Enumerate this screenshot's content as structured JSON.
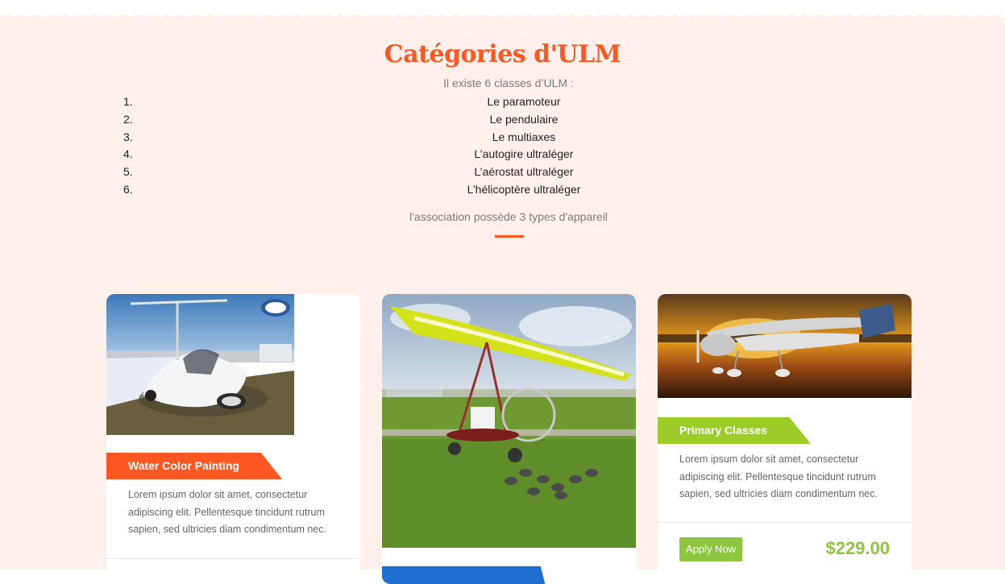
{
  "section": {
    "title": "Catégories d'ULM",
    "intro": "Il existe 6 classes d’ULM :",
    "items": [
      {
        "num": "1.",
        "label": "Le paramoteur"
      },
      {
        "num": "2.",
        "label": "Le pendulaire"
      },
      {
        "num": "3.",
        "label": "Le multiaxes"
      },
      {
        "num": "4.",
        "label": "L’autogire ultraléger"
      },
      {
        "num": "5.",
        "label": "L’aérostat ultraléger"
      },
      {
        "num": "6.",
        "label": "L’hélicoptère ultraléger"
      }
    ],
    "subtitle": "l'association possède 3 types d'appareil"
  },
  "cards": [
    {
      "tag": "Water Color Painting",
      "description": "Lorem ipsum dolor sit amet, consectetur adipiscing elit. Pellentesque tincidunt rutrum sapien, sed ultricies diam condimentum nec.",
      "image": "autogyro-photo"
    },
    {
      "tag": "",
      "image": "trike-microlight-photo"
    },
    {
      "tag": "Primary Classes",
      "description": "Lorem ipsum dolor sit amet, consectetur adipiscing elit. Pellentesque tincidunt rutrum sapien, sed ultricies diam condimentum nec.",
      "apply_label": "Apply Now",
      "price": "$229.00",
      "image": "multiaxis-plane-sunset-photo"
    }
  ],
  "colors": {
    "accent": "#ff5722",
    "green": "#8dc63f",
    "blue": "#1e6fd0",
    "section_bg": "#fff0ec"
  }
}
